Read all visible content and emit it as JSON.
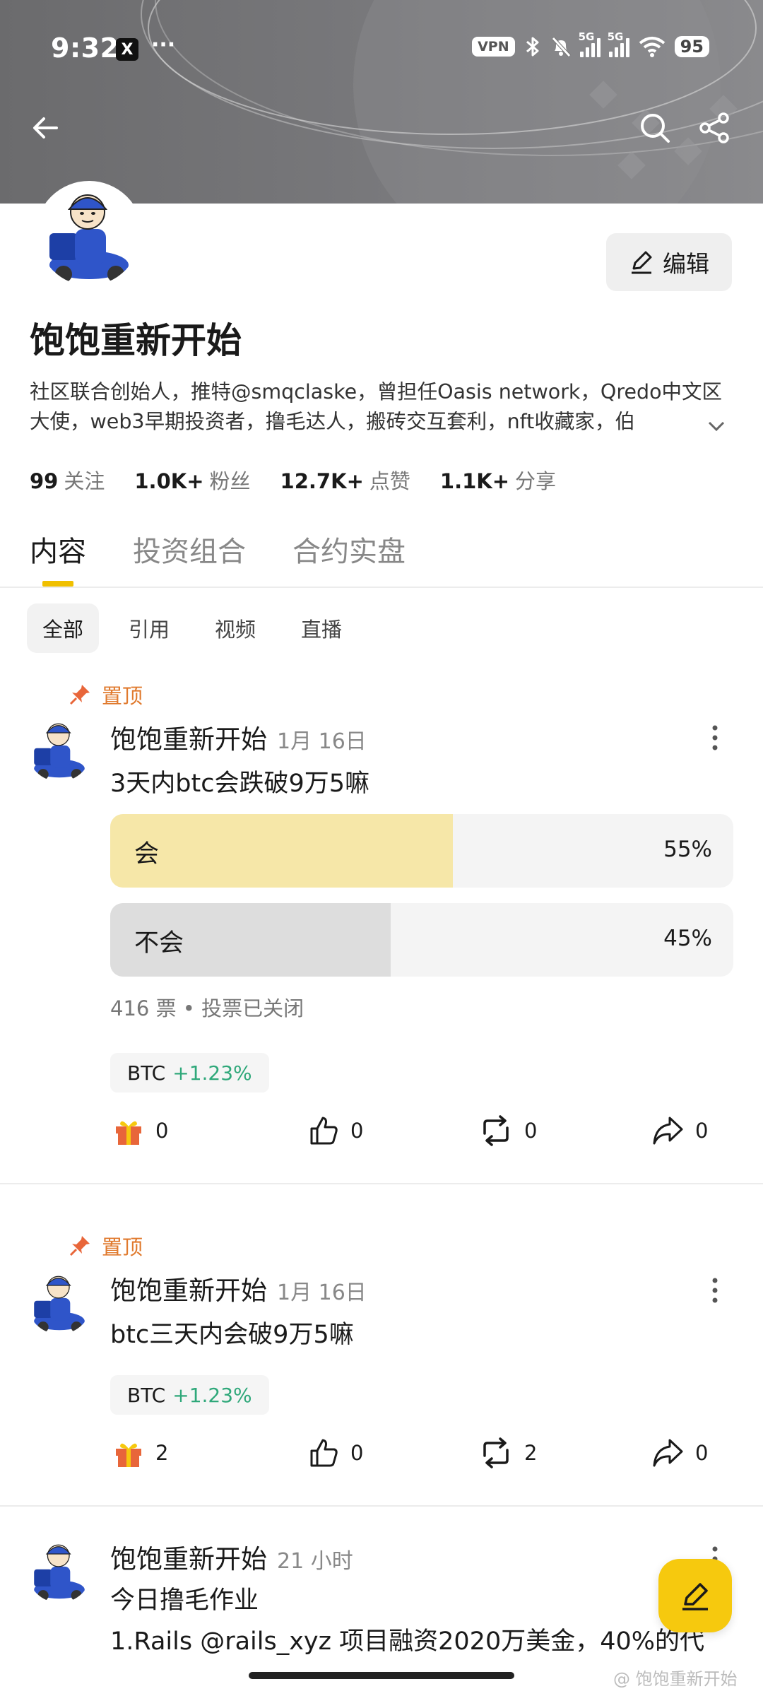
{
  "status_bar": {
    "time": "9:32",
    "x_badge": "X",
    "more": "···",
    "vpn": "VPN",
    "net1": "5G",
    "net2": "5G",
    "battery": "95"
  },
  "profile": {
    "name": "饱饱重新开始",
    "edit_label": "编辑",
    "bio": "社区联合创始人，推特@smqclaske，曾担任Oasis network，Qredo中文区大使，web3早期投资者，撸毛达人，搬砖交互套利，nft收藏家，伯",
    "stats": [
      {
        "num": "99",
        "label": "关注"
      },
      {
        "num": "1.0K+",
        "label": "粉丝"
      },
      {
        "num": "12.7K+",
        "label": "点赞"
      },
      {
        "num": "1.1K+",
        "label": "分享"
      }
    ]
  },
  "tabs": [
    "内容",
    "投资组合",
    "合约实盘"
  ],
  "subtabs": [
    "全部",
    "引用",
    "视频",
    "直播"
  ],
  "posts": [
    {
      "pinned_label": "置顶",
      "author": "饱饱重新开始",
      "date": "1月 16日",
      "text": "3天内btc会跌破9万5嘛",
      "poll": [
        {
          "label": "会",
          "pct": "55%",
          "value": 0.55,
          "color": "#f6e7a8"
        },
        {
          "label": "不会",
          "pct": "45%",
          "value": 0.45,
          "color": "#dddddd"
        }
      ],
      "poll_meta": "416 票 • 投票已关闭",
      "ticker": {
        "symbol": "BTC",
        "change": "+1.23%"
      },
      "counts": {
        "gift": "0",
        "like": "0",
        "repost": "0",
        "share": "0"
      }
    },
    {
      "pinned_label": "置顶",
      "author": "饱饱重新开始",
      "date": "1月 16日",
      "text": "btc三天内会破9万5嘛",
      "ticker": {
        "symbol": "BTC",
        "change": "+1.23%"
      },
      "counts": {
        "gift": "2",
        "like": "0",
        "repost": "2",
        "share": "0"
      }
    },
    {
      "author": "饱饱重新开始",
      "date": "21 小时",
      "text": "今日撸毛作业",
      "text2": "1.Rails @rails_xyz 项目融资2020万美金，40%的代"
    }
  ],
  "watermark": "@ 饱饱重新开始"
}
